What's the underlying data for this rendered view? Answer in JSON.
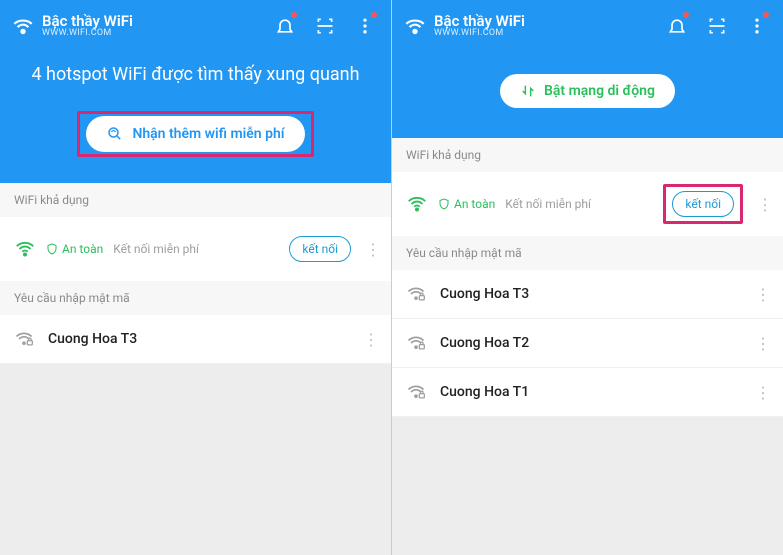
{
  "left": {
    "header": {
      "title": "Bậc thầy WiFi",
      "subtitle": "WWW.WIFI.COM",
      "hero": "4 hotspot WiFi được tìm thấy xung quanh",
      "cta": "Nhận thêm wifi miễn phí"
    },
    "available": {
      "label": "WiFi khả dụng",
      "safe": "An toàn",
      "free": "Kết nối miễn phí",
      "connect": "kết nối"
    },
    "password": {
      "label": "Yêu cầu nhập mật mã",
      "items": [
        "Cuong Hoa T3"
      ]
    }
  },
  "right": {
    "header": {
      "title": "Bậc thầy WiFi",
      "subtitle": "WWW.WIFI.COM",
      "cta": "Bật mạng di động"
    },
    "available": {
      "label": "WiFi khả dụng",
      "safe": "An toàn",
      "free": "Kết nối miễn phí",
      "connect": "kết nối"
    },
    "password": {
      "label": "Yêu cầu nhập mật mã",
      "items": [
        "Cuong Hoa T3",
        "Cuong Hoa T2",
        "Cuong Hoa T1"
      ]
    }
  }
}
